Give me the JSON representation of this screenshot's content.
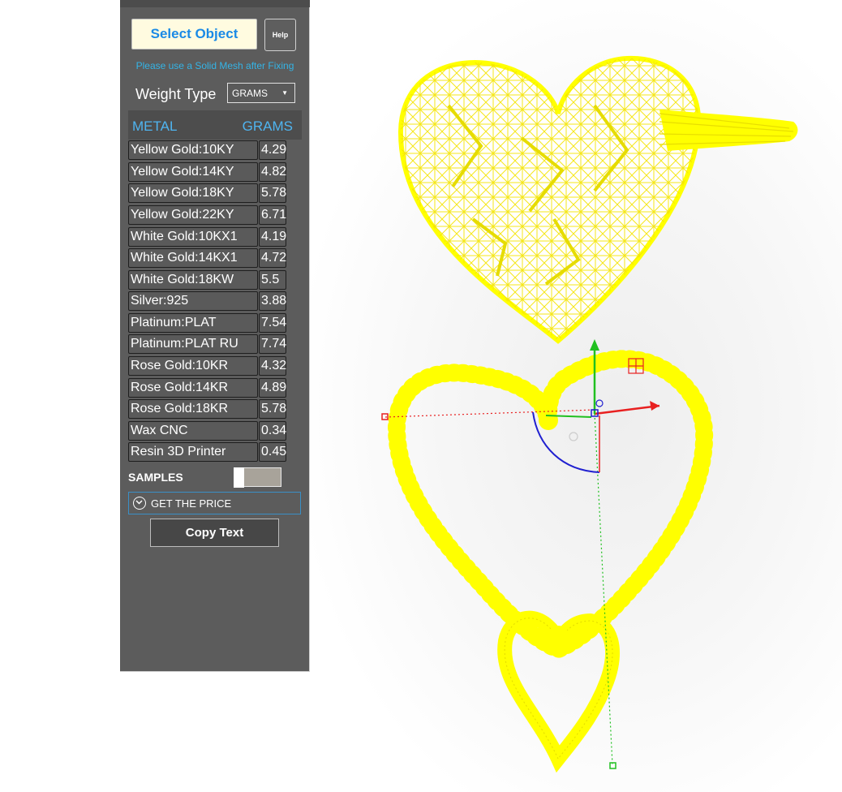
{
  "panel": {
    "select_button": "Select Object",
    "help_button": "Help",
    "hint": "Please use a Solid Mesh after Fixing",
    "weight_type_label": "Weight Type",
    "weight_type_value": "GRAMS",
    "table": {
      "col_metal": "METAL",
      "col_grams": "GRAMS",
      "rows": [
        {
          "metal": "Yellow Gold:10KY",
          "grams": "4.29"
        },
        {
          "metal": "Yellow Gold:14KY",
          "grams": "4.82"
        },
        {
          "metal": "Yellow Gold:18KY",
          "grams": "5.78"
        },
        {
          "metal": "Yellow Gold:22KY",
          "grams": "6.71"
        },
        {
          "metal": "White Gold:10KX1",
          "grams": "4.19"
        },
        {
          "metal": "White Gold:14KX1",
          "grams": "4.72"
        },
        {
          "metal": "White Gold:18KW",
          "grams": "5.5"
        },
        {
          "metal": "Silver:925",
          "grams": "3.88"
        },
        {
          "metal": "Platinum:PLAT",
          "grams": "7.54"
        },
        {
          "metal": "Platinum:PLAT RU",
          "grams": "7.74"
        },
        {
          "metal": "Rose Gold:10KR",
          "grams": "4.32"
        },
        {
          "metal": "Rose Gold:14KR",
          "grams": "4.89"
        },
        {
          "metal": "Rose Gold:18KR",
          "grams": "5.78"
        },
        {
          "metal": "Wax  CNC",
          "grams": "0.34"
        },
        {
          "metal": "Resin 3D Printer",
          "grams": "0.45"
        }
      ]
    },
    "samples_label": "SAMPLES",
    "samples_toggle_on": false,
    "get_price_label": "GET THE PRICE",
    "copy_text_button": "Copy Text"
  },
  "viewport": {
    "mesh_color": "#ffff00",
    "gizmo_colors": {
      "x_axis": "#e82020",
      "y_axis": "#20c020",
      "z_axis": "#2020d0"
    }
  }
}
